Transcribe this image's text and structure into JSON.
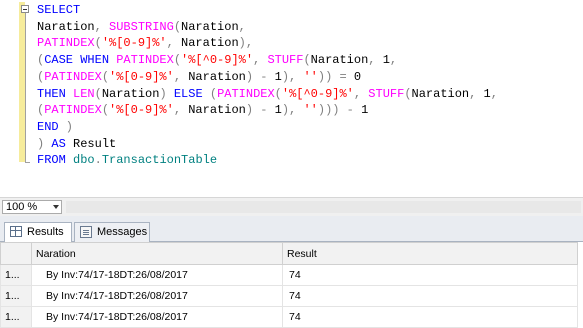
{
  "editor": {
    "lines": [
      "SELECT",
      "Naration, SUBSTRING(Naration,",
      "PATINDEX('%[0-9]%', Naration),",
      "(CASE WHEN PATINDEX('%[^0-9]%', STUFF(Naration, 1,",
      "(PATINDEX('%[0-9]%', Naration) - 1), '')) = 0",
      "THEN LEN(Naration) ELSE (PATINDEX('%[^0-9]%', STUFF(Naration, 1,",
      "(PATINDEX('%[0-9]%', Naration) - 1), ''))) - 1",
      "END )",
      ") AS Result",
      "FROM dbo.TransactionTable"
    ]
  },
  "zoom": {
    "value": "100 %"
  },
  "tabs": {
    "results": "Results",
    "messages": "Messages"
  },
  "grid": {
    "columns": [
      "Naration",
      "Result"
    ],
    "rows": [
      {
        "num": "1...",
        "naration": "By Inv:74/17-18DT:26/08/2017",
        "result": "74"
      },
      {
        "num": "1...",
        "naration": "By Inv:74/17-18DT:26/08/2017",
        "result": "74"
      },
      {
        "num": "1...",
        "naration": "By Inv:74/17-18DT:26/08/2017",
        "result": "74"
      }
    ]
  },
  "colors": {
    "keyword": "#0000ff",
    "function": "#ff00ff",
    "string": "#ff0000",
    "operator": "#808080",
    "change_bar": "#f6ec9c"
  }
}
